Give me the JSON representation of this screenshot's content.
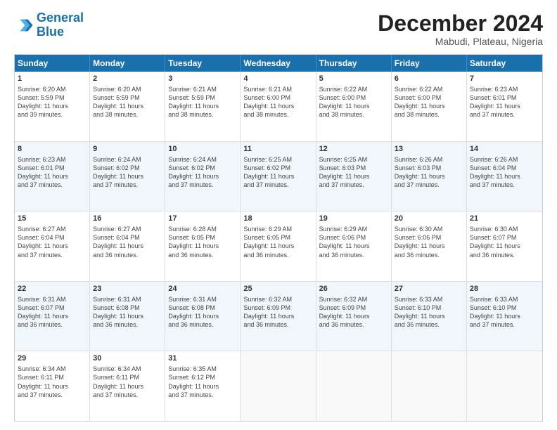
{
  "logo": {
    "line1": "General",
    "line2": "Blue"
  },
  "calendar": {
    "title": "December 2024",
    "subtitle": "Mabudi, Plateau, Nigeria",
    "headers": [
      "Sunday",
      "Monday",
      "Tuesday",
      "Wednesday",
      "Thursday",
      "Friday",
      "Saturday"
    ],
    "weeks": [
      [
        {
          "day": "1",
          "info": "Sunrise: 6:20 AM\nSunset: 5:59 PM\nDaylight: 11 hours\nand 39 minutes."
        },
        {
          "day": "2",
          "info": "Sunrise: 6:20 AM\nSunset: 5:59 PM\nDaylight: 11 hours\nand 38 minutes."
        },
        {
          "day": "3",
          "info": "Sunrise: 6:21 AM\nSunset: 5:59 PM\nDaylight: 11 hours\nand 38 minutes."
        },
        {
          "day": "4",
          "info": "Sunrise: 6:21 AM\nSunset: 6:00 PM\nDaylight: 11 hours\nand 38 minutes."
        },
        {
          "day": "5",
          "info": "Sunrise: 6:22 AM\nSunset: 6:00 PM\nDaylight: 11 hours\nand 38 minutes."
        },
        {
          "day": "6",
          "info": "Sunrise: 6:22 AM\nSunset: 6:00 PM\nDaylight: 11 hours\nand 38 minutes."
        },
        {
          "day": "7",
          "info": "Sunrise: 6:23 AM\nSunset: 6:01 PM\nDaylight: 11 hours\nand 37 minutes."
        }
      ],
      [
        {
          "day": "8",
          "info": "Sunrise: 6:23 AM\nSunset: 6:01 PM\nDaylight: 11 hours\nand 37 minutes."
        },
        {
          "day": "9",
          "info": "Sunrise: 6:24 AM\nSunset: 6:02 PM\nDaylight: 11 hours\nand 37 minutes."
        },
        {
          "day": "10",
          "info": "Sunrise: 6:24 AM\nSunset: 6:02 PM\nDaylight: 11 hours\nand 37 minutes."
        },
        {
          "day": "11",
          "info": "Sunrise: 6:25 AM\nSunset: 6:02 PM\nDaylight: 11 hours\nand 37 minutes."
        },
        {
          "day": "12",
          "info": "Sunrise: 6:25 AM\nSunset: 6:03 PM\nDaylight: 11 hours\nand 37 minutes."
        },
        {
          "day": "13",
          "info": "Sunrise: 6:26 AM\nSunset: 6:03 PM\nDaylight: 11 hours\nand 37 minutes."
        },
        {
          "day": "14",
          "info": "Sunrise: 6:26 AM\nSunset: 6:04 PM\nDaylight: 11 hours\nand 37 minutes."
        }
      ],
      [
        {
          "day": "15",
          "info": "Sunrise: 6:27 AM\nSunset: 6:04 PM\nDaylight: 11 hours\nand 37 minutes."
        },
        {
          "day": "16",
          "info": "Sunrise: 6:27 AM\nSunset: 6:04 PM\nDaylight: 11 hours\nand 36 minutes."
        },
        {
          "day": "17",
          "info": "Sunrise: 6:28 AM\nSunset: 6:05 PM\nDaylight: 11 hours\nand 36 minutes."
        },
        {
          "day": "18",
          "info": "Sunrise: 6:29 AM\nSunset: 6:05 PM\nDaylight: 11 hours\nand 36 minutes."
        },
        {
          "day": "19",
          "info": "Sunrise: 6:29 AM\nSunset: 6:06 PM\nDaylight: 11 hours\nand 36 minutes."
        },
        {
          "day": "20",
          "info": "Sunrise: 6:30 AM\nSunset: 6:06 PM\nDaylight: 11 hours\nand 36 minutes."
        },
        {
          "day": "21",
          "info": "Sunrise: 6:30 AM\nSunset: 6:07 PM\nDaylight: 11 hours\nand 36 minutes."
        }
      ],
      [
        {
          "day": "22",
          "info": "Sunrise: 6:31 AM\nSunset: 6:07 PM\nDaylight: 11 hours\nand 36 minutes."
        },
        {
          "day": "23",
          "info": "Sunrise: 6:31 AM\nSunset: 6:08 PM\nDaylight: 11 hours\nand 36 minutes."
        },
        {
          "day": "24",
          "info": "Sunrise: 6:31 AM\nSunset: 6:08 PM\nDaylight: 11 hours\nand 36 minutes."
        },
        {
          "day": "25",
          "info": "Sunrise: 6:32 AM\nSunset: 6:09 PM\nDaylight: 11 hours\nand 36 minutes."
        },
        {
          "day": "26",
          "info": "Sunrise: 6:32 AM\nSunset: 6:09 PM\nDaylight: 11 hours\nand 36 minutes."
        },
        {
          "day": "27",
          "info": "Sunrise: 6:33 AM\nSunset: 6:10 PM\nDaylight: 11 hours\nand 36 minutes."
        },
        {
          "day": "28",
          "info": "Sunrise: 6:33 AM\nSunset: 6:10 PM\nDaylight: 11 hours\nand 37 minutes."
        }
      ],
      [
        {
          "day": "29",
          "info": "Sunrise: 6:34 AM\nSunset: 6:11 PM\nDaylight: 11 hours\nand 37 minutes."
        },
        {
          "day": "30",
          "info": "Sunrise: 6:34 AM\nSunset: 6:11 PM\nDaylight: 11 hours\nand 37 minutes."
        },
        {
          "day": "31",
          "info": "Sunrise: 6:35 AM\nSunset: 6:12 PM\nDaylight: 11 hours\nand 37 minutes."
        },
        {
          "day": "",
          "info": ""
        },
        {
          "day": "",
          "info": ""
        },
        {
          "day": "",
          "info": ""
        },
        {
          "day": "",
          "info": ""
        }
      ]
    ]
  }
}
